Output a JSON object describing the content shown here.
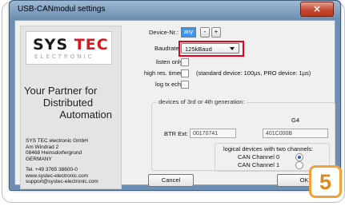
{
  "window": {
    "title": "USB-CANmodul settings",
    "close_glyph": "×"
  },
  "logo": {
    "brand_a": "SYS",
    "brand_b": "TEC",
    "sub": "ELECTRONIC"
  },
  "tagline": {
    "line1": "Your Partner for",
    "line2": "Distributed",
    "line3": "Automation"
  },
  "address": [
    "SYS TEC electronic GmbH",
    "Am Windrad 2",
    "08468 Heinsdorfergrund",
    "GERMANY"
  ],
  "contact": [
    "Tel. +49 3765 38600-0",
    "www.systec-electronic.com",
    "support@systec-electronic.com"
  ],
  "form": {
    "device_nr_label": "Device-Nr.:",
    "device_nr_value": "any",
    "minus_label": "-",
    "plus_label": "+",
    "baudrate_label": "Baudrate:",
    "baudrate_value": "125kBaud",
    "listen_only_label": "listen only:",
    "high_res_label": "high res. timer:",
    "high_res_note": "(standard device: 100µs, PRO device: 1µs)",
    "log_tx_label": "log tx echo:"
  },
  "generation": {
    "title": "devices of 3rd or 4th generation:",
    "column_header": "G4",
    "btr_ext_label": "BTR Ext:",
    "btr_ext_value": "00170741",
    "g4_value": "401C000B",
    "logical_title": "logical devices with two channels:",
    "channel0_label": "CAN Channel 0",
    "channel1_label": "CAN Channel 1",
    "channel0_selected": true
  },
  "buttons": {
    "cancel": "Cancel",
    "ok": "OK"
  },
  "badge": {
    "number": "5",
    "color": "#e08a1e"
  },
  "colors": {
    "accent_red": "#e2001a",
    "title_bar": "#6f90b3"
  }
}
